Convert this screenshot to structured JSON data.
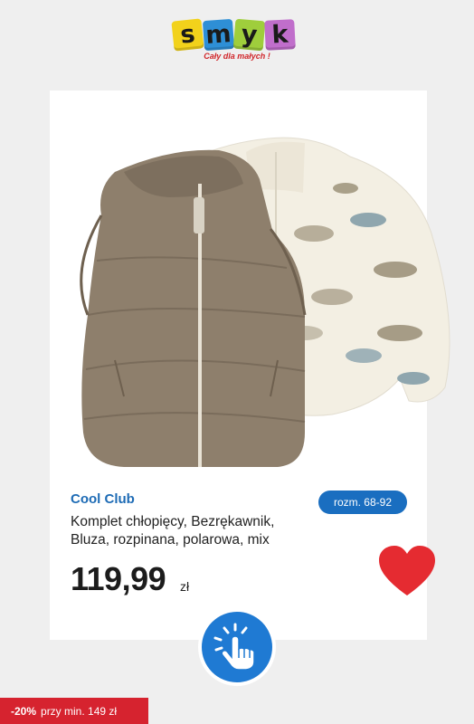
{
  "logo": {
    "letters": [
      "s",
      "m",
      "y",
      "k"
    ],
    "tagline": "Cały dla małych !"
  },
  "product": {
    "brand": "Cool Club",
    "size_badge": "rozm. 68-92",
    "title": "Komplet chłopięcy, Bezrękawnik, Bluza, rozpinana, polarowa, mix",
    "price": "119,99",
    "currency": "zł",
    "image_icon": "vest-and-dino-fleece-jacket"
  },
  "actions": {
    "favorite_icon": "heart-icon",
    "tap_icon": "tap-hand-icon"
  },
  "promo": {
    "discount": "-20%",
    "text": "przy min. 149 zł"
  },
  "colors": {
    "brand_blue": "#1d6bb5",
    "badge_blue": "#1a6ec0",
    "heart_red": "#e52b31",
    "promo_red": "#d6232f"
  }
}
